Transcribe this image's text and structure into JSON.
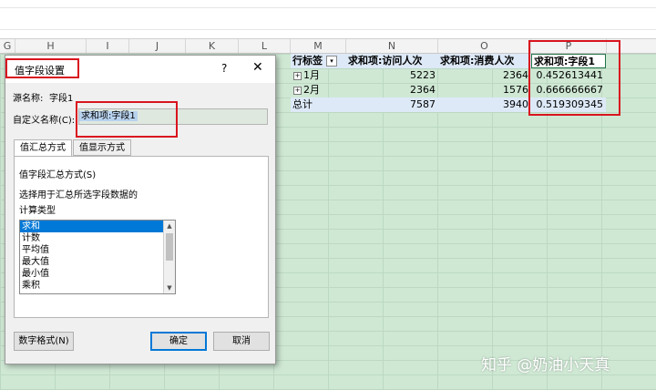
{
  "columns": [
    "G",
    "H",
    "I",
    "J",
    "K",
    "L",
    "M",
    "N",
    "O",
    "P"
  ],
  "pivot": {
    "header": {
      "label": "行标签",
      "col1": "求和项:访问人次",
      "col2": "求和项:消费人次",
      "col3": "求和项:字段1"
    },
    "rows": [
      {
        "label": "1月",
        "v1": "5223",
        "v2": "2364",
        "v3": "0.452613441"
      },
      {
        "label": "2月",
        "v1": "2364",
        "v2": "1576",
        "v3": "0.666666667"
      }
    ],
    "total": {
      "label": "总计",
      "v1": "7587",
      "v2": "3940",
      "v3": "0.519309345"
    }
  },
  "dialog": {
    "title": "值字段设置",
    "help": "?",
    "close": "✕",
    "source_label": "源名称:",
    "source_value": "字段1",
    "custom_name_label": "自定义名称(C):",
    "custom_name_value": "求和项:字段1",
    "tabs": [
      "值汇总方式",
      "值显示方式"
    ],
    "section_title": "值字段汇总方式(S)",
    "description": "选择用于汇总所选字段数据的",
    "calc_type_label": "计算类型",
    "calc_types": [
      "求和",
      "计数",
      "平均值",
      "最大值",
      "最小值",
      "乘积"
    ],
    "number_format_button": "数字格式(N)",
    "ok_button": "确定",
    "cancel_button": "取消"
  },
  "watermark": "知乎 @奶油小天真",
  "colors": {
    "highlight_red": "#d9141e",
    "selection_blue": "#0078d7",
    "sheet_green": "#cfe8d4"
  }
}
